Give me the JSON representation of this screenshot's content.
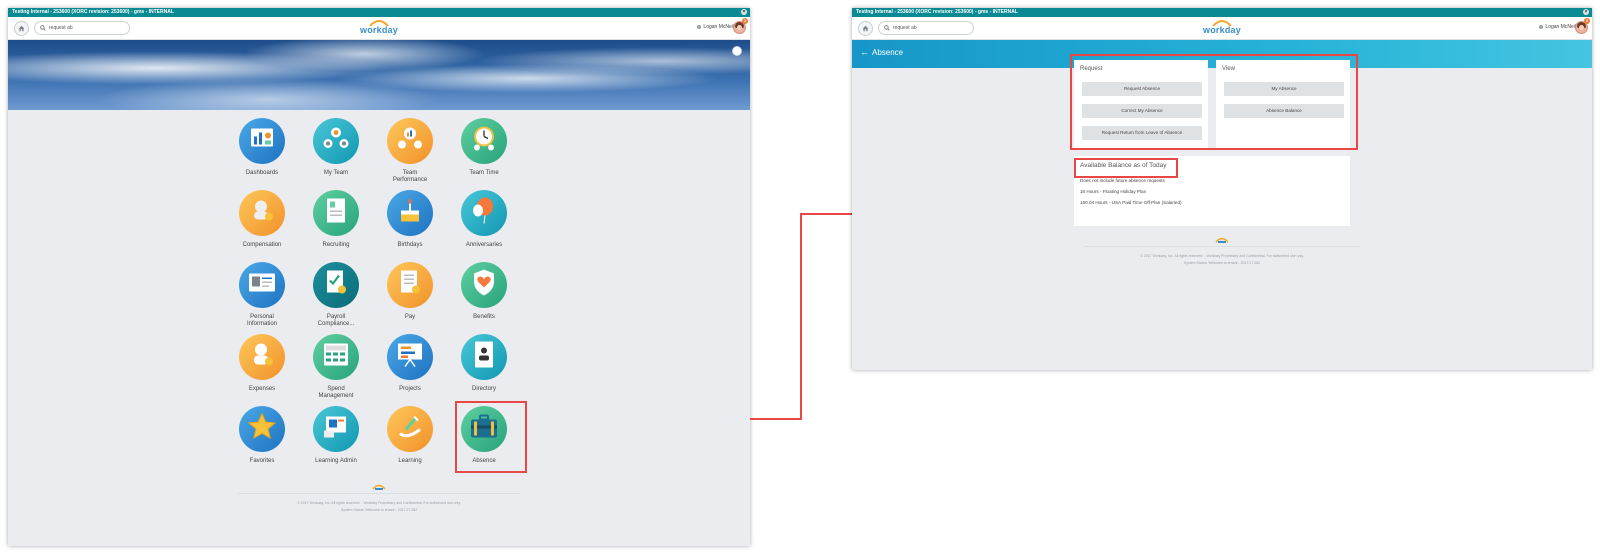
{
  "topbar": {
    "text": "Testing Internal - 253600 (XORC revision: 253600) - gms - INTERNAL",
    "close": "×"
  },
  "header": {
    "search_value": "request ab",
    "logo": "workday",
    "user_name": "Logan McNeil",
    "notification_count": "2"
  },
  "apps": [
    {
      "label": "Dashboards",
      "icon": "dashboards-icon",
      "color": "blue"
    },
    {
      "label": "My Team",
      "icon": "team-icon",
      "color": "teal"
    },
    {
      "label": "Team\nPerformance",
      "icon": "performance-icon",
      "color": "orange"
    },
    {
      "label": "Team Time",
      "icon": "clock-icon",
      "color": "green"
    },
    {
      "label": "Compensation",
      "icon": "compensation-icon",
      "color": "orange"
    },
    {
      "label": "Recruiting",
      "icon": "recruiting-icon",
      "color": "green"
    },
    {
      "label": "Birthdays",
      "icon": "cake-icon",
      "color": "blue"
    },
    {
      "label": "Anniversaries",
      "icon": "balloon-icon",
      "color": "teal"
    },
    {
      "label": "Personal\nInformation",
      "icon": "id-card-icon",
      "color": "blue"
    },
    {
      "label": "Payroll\nCompliance...",
      "icon": "payroll-icon",
      "color": "dteal"
    },
    {
      "label": "Pay",
      "icon": "pay-icon",
      "color": "orange"
    },
    {
      "label": "Benefits",
      "icon": "shield-heart-icon",
      "color": "green"
    },
    {
      "label": "Expenses",
      "icon": "expenses-icon",
      "color": "orange"
    },
    {
      "label": "Spend\nManagement",
      "icon": "calculator-icon",
      "color": "green"
    },
    {
      "label": "Projects",
      "icon": "projects-icon",
      "color": "blue"
    },
    {
      "label": "Directory",
      "icon": "directory-icon",
      "color": "teal"
    },
    {
      "label": "Favorites",
      "icon": "star-icon",
      "color": "blue"
    },
    {
      "label": "Learning Admin",
      "icon": "learning-admin-icon",
      "color": "teal"
    },
    {
      "label": "Learning",
      "icon": "learning-icon",
      "color": "orange"
    },
    {
      "label": "Absence",
      "icon": "suitcase-icon",
      "color": "green"
    }
  ],
  "footer": {
    "copyright": "© 2017 Workday, Inc. All rights reserved. - Workday Proprietary and Confidential. For authorized use only.",
    "status": "System Status: Welcome to tenant - 2017.27.282"
  },
  "absence": {
    "title": "Absence",
    "request_heading": "Request",
    "view_heading": "View",
    "request_buttons": [
      "Request Absence",
      "Correct My Absence",
      "Request Return from Leave of Absence"
    ],
    "view_buttons": [
      "My Absence",
      "Absence Balance"
    ],
    "balance_heading": "Available Balance as of Today",
    "balance_note": "Does not include future absence requests",
    "balance_lines": [
      "16 Hours - Floating Holiday Plan",
      "160.04 Hours - USA Paid Time Off Plan (Salaried)"
    ]
  },
  "colors": {
    "accent_red": "#e84845",
    "teal_bar": "#0a8a93",
    "absence_bar": "#1696c9"
  }
}
